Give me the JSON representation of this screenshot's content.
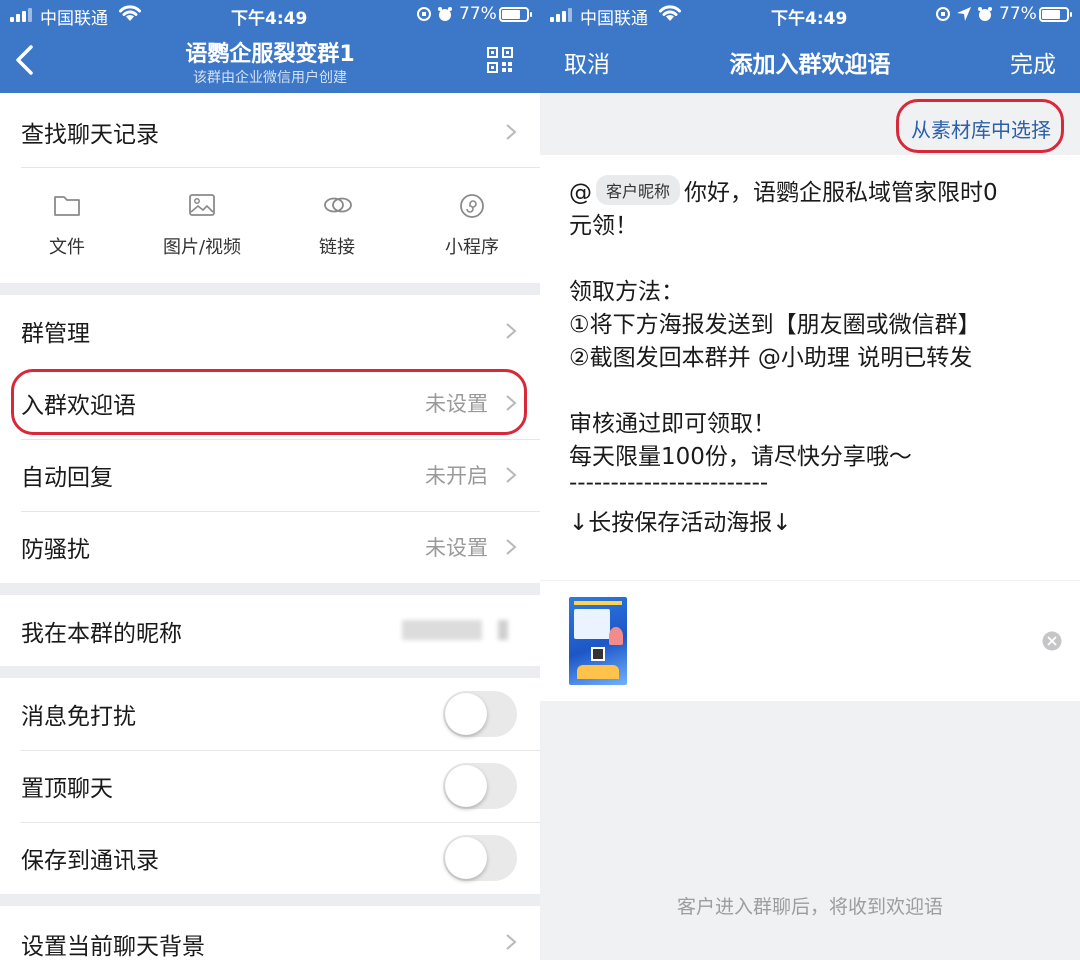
{
  "status_bar_left": {
    "carrier": "中国联通",
    "time": "下午4:49",
    "battery": "77%"
  },
  "status_bar_right": {
    "carrier": "中国联通",
    "time": "下午4:49",
    "battery": "77%"
  },
  "left": {
    "header": {
      "title": "语鹦企服裂变群1",
      "subtitle": "该群由企业微信用户创建"
    },
    "search_history": "查找聊天记录",
    "attachments": [
      {
        "label": "文件",
        "icon": "folder-icon"
      },
      {
        "label": "图片/视频",
        "icon": "image-icon"
      },
      {
        "label": "链接",
        "icon": "link-icon"
      },
      {
        "label": "小程序",
        "icon": "mini-program-icon"
      }
    ],
    "group_manage": "群管理",
    "welcome": {
      "label": "入群欢迎语",
      "value": "未设置"
    },
    "auto_reply": {
      "label": "自动回复",
      "value": "未开启"
    },
    "anti_harass": {
      "label": "防骚扰",
      "value": "未设置"
    },
    "nickname_label": "我在本群的昵称",
    "mute": {
      "label": "消息免打扰",
      "on": false
    },
    "pin": {
      "label": "置顶聊天",
      "on": false
    },
    "save_contacts": {
      "label": "保存到通讯录",
      "on": false
    },
    "chat_bg": "设置当前聊天背景"
  },
  "right": {
    "header": {
      "cancel": "取消",
      "title": "添加入群欢迎语",
      "done": "完成"
    },
    "material_link": "从素材库中选择",
    "message": {
      "at": "@",
      "tag": "客户昵称",
      "line1_rest": "你好，语鹦企服私域管家限时0",
      "line2": "元领！",
      "line3": "领取方法：",
      "line4": "①将下方海报发送到【朋友圈或微信群】",
      "line5": "②截图发回本群并 @小助理 说明已转发",
      "line6": "审核通过即可领取！",
      "line7": "每天限量100份，请尽快分享哦～",
      "line8": "------------------------",
      "line9": "↓长按保存活动海报↓"
    },
    "footer_hint": "客户进入群聊后，将收到欢迎语"
  },
  "colors": {
    "header_blue": "#3c77c8",
    "highlight_red": "#d8283a",
    "link_blue": "#2b5fa8"
  }
}
